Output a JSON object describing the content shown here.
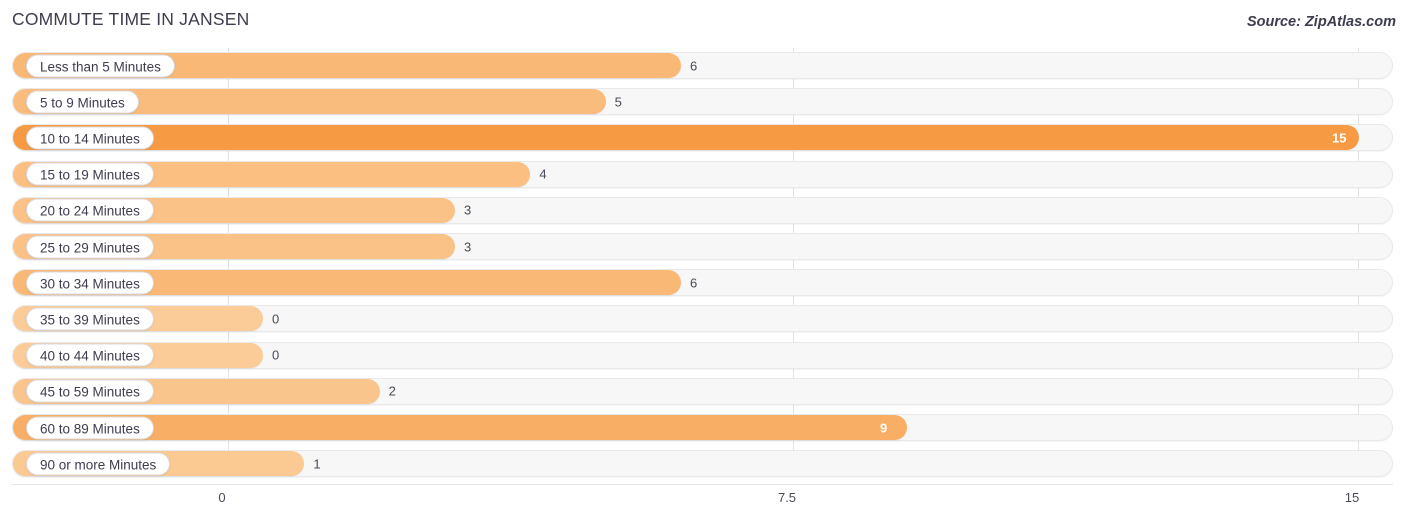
{
  "header": {
    "title": "COMMUTE TIME IN JANSEN",
    "source": "Source: ZipAtlas.com"
  },
  "chart_data": {
    "type": "bar",
    "orientation": "horizontal",
    "title": "COMMUTE TIME IN JANSEN",
    "xlabel": "",
    "ylabel": "",
    "xlim": [
      0,
      15
    ],
    "grid": true,
    "legend": null,
    "ticks": [
      "0",
      "7.5",
      "15"
    ],
    "tick_values": [
      0,
      7.5,
      15
    ],
    "categories": [
      "Less than 5 Minutes",
      "5 to 9 Minutes",
      "10 to 14 Minutes",
      "15 to 19 Minutes",
      "20 to 24 Minutes",
      "25 to 29 Minutes",
      "30 to 34 Minutes",
      "35 to 39 Minutes",
      "40 to 44 Minutes",
      "45 to 59 Minutes",
      "60 to 89 Minutes",
      "90 or more Minutes"
    ],
    "values": [
      6,
      5,
      15,
      4,
      3,
      3,
      6,
      0,
      0,
      2,
      9,
      1
    ],
    "value_labels": [
      "6",
      "5",
      "15",
      "4",
      "3",
      "3",
      "6",
      "0",
      "0",
      "2",
      "9",
      "1"
    ],
    "colors": {
      "bar_min": "#FBCC98",
      "bar_max": "#F69B43",
      "track": "#F7F7F8",
      "track_border": "#E9E9EC",
      "gridline": "#E2E2E6",
      "text": "#3D3D4E",
      "value_text": "#4A4A55",
      "value_text_inside": "#FFFFFF",
      "pill_bg": "#FFFFFF",
      "pill_border": "#D9D9DE"
    }
  }
}
